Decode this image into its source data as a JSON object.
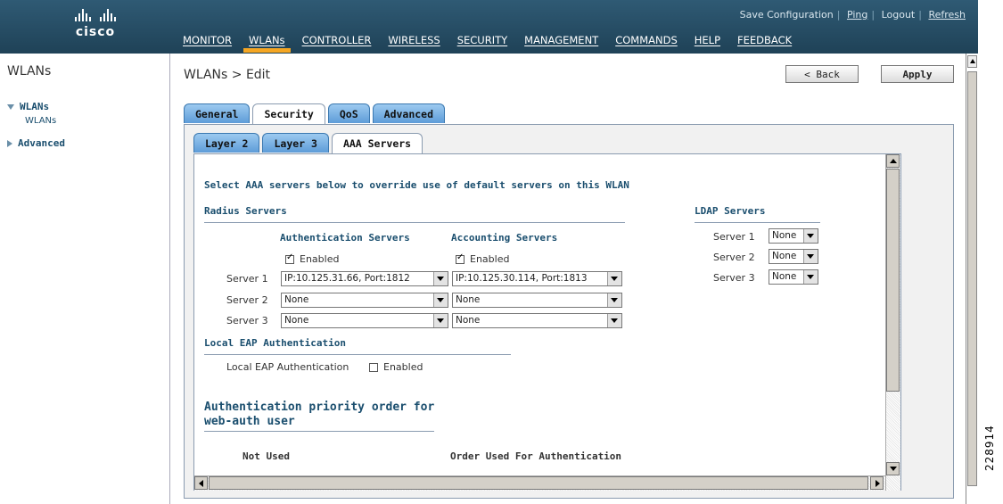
{
  "header": {
    "logo_text": "cisco",
    "utility_links": [
      "Save Configuration",
      "Ping",
      "Logout",
      "Refresh"
    ],
    "nav": [
      "MONITOR",
      "WLANs",
      "CONTROLLER",
      "WIRELESS",
      "SECURITY",
      "MANAGEMENT",
      "COMMANDS",
      "HELP",
      "FEEDBACK"
    ],
    "active_nav": "WLANs",
    "accent_color": "#f5a623"
  },
  "sidebar": {
    "title": "WLANs",
    "items": [
      {
        "label": "WLANs",
        "expanded": true,
        "sub": "WLANs"
      },
      {
        "label": "Advanced",
        "expanded": false
      }
    ]
  },
  "main": {
    "title": "WLANs > Edit",
    "back_label": "< Back",
    "apply_label": "Apply",
    "tabs": [
      "General",
      "Security",
      "QoS",
      "Advanced"
    ],
    "active_tab": "Security",
    "subtabs": [
      "Layer 2",
      "Layer 3",
      "AAA Servers"
    ],
    "active_subtab": "AAA Servers"
  },
  "aaa": {
    "intro": "Select AAA servers below to override use of default servers on this WLAN",
    "radius_heading": "Radius Servers",
    "auth_heading": "Authentication Servers",
    "acct_heading": "Accounting Servers",
    "enabled_label": "Enabled",
    "auth_enabled": true,
    "acct_enabled": true,
    "servers": [
      {
        "label": "Server 1",
        "auth": "IP:10.125.31.66, Port:1812",
        "acct": "IP:10.125.30.114, Port:1813"
      },
      {
        "label": "Server 2",
        "auth": "None",
        "acct": "None"
      },
      {
        "label": "Server 3",
        "auth": "None",
        "acct": "None"
      }
    ],
    "ldap_heading": "LDAP Servers",
    "ldap": [
      {
        "label": "Server 1",
        "value": "None"
      },
      {
        "label": "Server 2",
        "value": "None"
      },
      {
        "label": "Server 3",
        "value": "None"
      }
    ],
    "local_eap_heading": "Local EAP Authentication",
    "local_eap_label": "Local EAP Authentication",
    "local_eap_enabled_label": "Enabled",
    "priority_heading_1": "Authentication priority order for",
    "priority_heading_2": "web-auth user",
    "not_used_label": "Not Used",
    "order_used_label": "Order Used For Authentication"
  },
  "figure_id": "228914"
}
